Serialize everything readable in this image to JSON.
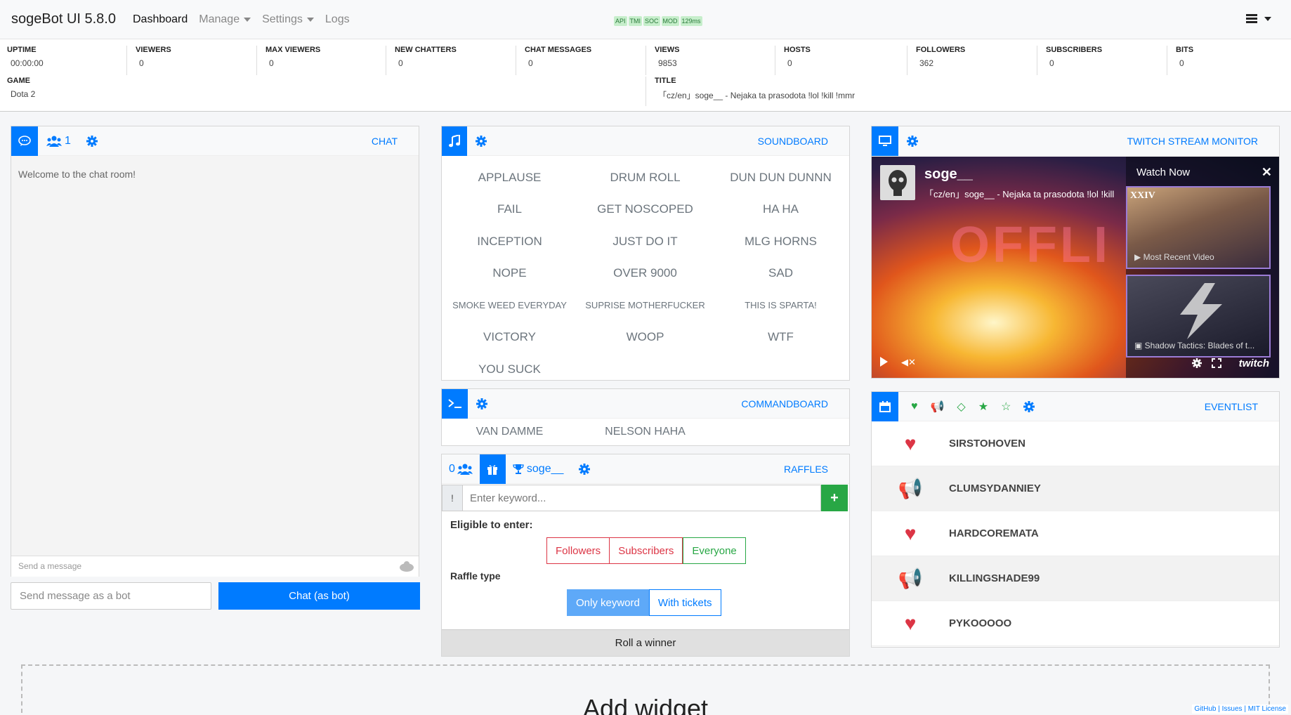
{
  "navbar": {
    "brand": "sogeBot UI 5.8.0",
    "links": [
      "Dashboard",
      "Manage",
      "Settings",
      "Logs"
    ],
    "badges": [
      "API",
      "TMI",
      "SOC",
      "MOD",
      "129ms"
    ]
  },
  "stats": {
    "uptime": {
      "label": "UPTIME",
      "value": "00:00:00"
    },
    "viewers": {
      "label": "VIEWERS",
      "value": "0"
    },
    "max_viewers": {
      "label": "MAX VIEWERS",
      "value": "0"
    },
    "new_chatters": {
      "label": "NEW CHATTERS",
      "value": "0"
    },
    "chat_messages": {
      "label": "CHAT MESSAGES",
      "value": "0"
    },
    "views": {
      "label": "VIEWS",
      "value": "9853"
    },
    "hosts": {
      "label": "HOSTS",
      "value": "0"
    },
    "followers": {
      "label": "FOLLOWERS",
      "value": "362"
    },
    "subscribers": {
      "label": "SUBSCRIBERS",
      "value": "0"
    },
    "bits": {
      "label": "BITS",
      "value": "0"
    },
    "game": {
      "label": "GAME",
      "value": "Dota 2"
    },
    "title": {
      "label": "TITLE",
      "value": "「cz/en」soge__ - Nejaka ta prasodota !lol !kill !mmr"
    }
  },
  "chat": {
    "title": "CHAT",
    "users_count": "1",
    "welcome": "Welcome to the chat room!",
    "message_placeholder": "Send a message",
    "bot_placeholder": "Send message as a bot",
    "bot_button": "Chat (as bot)"
  },
  "soundboard": {
    "title": "SOUNDBOARD",
    "sounds": [
      "APPLAUSE",
      "DRUM ROLL",
      "DUN DUN DUNNN",
      "FAIL",
      "GET NOSCOPED",
      "HA HA",
      "INCEPTION",
      "JUST DO IT",
      "MLG HORNS",
      "NOPE",
      "OVER 9000",
      "SAD",
      "SMOKE WEED EVERYDAY",
      "SUPRISE MOTHERFUCKER",
      "THIS IS SPARTA!",
      "VICTORY",
      "WOOP",
      "WTF",
      "YOU SUCK"
    ]
  },
  "commandboard": {
    "title": "COMMANDBOARD",
    "commands": [
      "VAN DAMME",
      "NELSON HAHA"
    ]
  },
  "raffles": {
    "title": "RAFFLES",
    "participants": "0",
    "winner_tab": "soge__",
    "keyword_prefix": "!",
    "keyword_placeholder": "Enter keyword...",
    "eligible_label": "Eligible to enter:",
    "eligible_options": [
      "Followers",
      "Subscribers",
      "Everyone"
    ],
    "type_label": "Raffle type",
    "type_options": [
      "Only keyword",
      "With tickets"
    ],
    "roll_button": "Roll a winner"
  },
  "stream_monitor": {
    "title": "TWITCH STREAM MONITOR",
    "channel": "soge__",
    "stream_title": "「cz/en」soge__ - Nejaka ta prasodota !lol !kill",
    "offline_text": "OFFLI",
    "watch_now": "Watch Now",
    "thumb1_badge": "XXIV",
    "thumb1_caption": "Most Recent Video",
    "thumb2_caption": "Shadow Tactics: Blades of t...",
    "logo": "twitch"
  },
  "eventlist": {
    "title": "EVENTLIST",
    "events": [
      {
        "type": "follow",
        "name": "SIRSTOHOVEN"
      },
      {
        "type": "host",
        "name": "CLUMSYDANNIEY"
      },
      {
        "type": "follow",
        "name": "HARDCOREMATA"
      },
      {
        "type": "host",
        "name": "KILLINGSHADE99"
      },
      {
        "type": "follow",
        "name": "PYKOOOOO"
      }
    ]
  },
  "add_widget": "Add widget",
  "footer": "GitHub | Issues | MIT License",
  "colors": {
    "accent": "#007bff",
    "success": "#28a745",
    "danger": "#dc3545",
    "host": "#fd7e14"
  }
}
